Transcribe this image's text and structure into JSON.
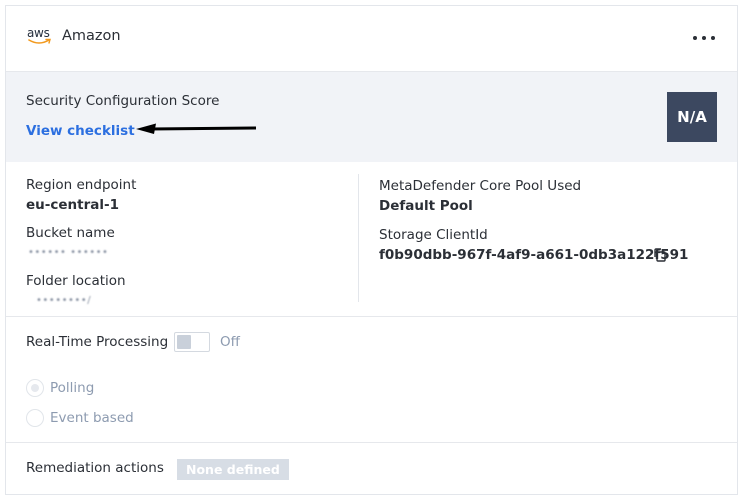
{
  "provider": {
    "logo_text": "aws",
    "name": "Amazon",
    "menu_icon": "more-horizontal-icon"
  },
  "score": {
    "title": "Security Configuration Score",
    "link_label": "View checklist",
    "badge": "N/A",
    "badge_color": "#3c4860"
  },
  "details": {
    "region_label": "Region endpoint",
    "region_value": "eu-central-1",
    "bucket_label": "Bucket name",
    "bucket_value": "•••••• ••••••",
    "folder_label": "Folder location",
    "folder_value": "••••••••/",
    "pool_label": "MetaDefender Core Pool Used",
    "pool_value": "Default Pool",
    "client_label": "Storage ClientId",
    "client_value": "f0b90dbb-967f-4af9-a661-0db3a122f591",
    "copy_icon": "copy-icon"
  },
  "realtime": {
    "label": "Real-Time Processing",
    "toggle_state": "Off",
    "options": [
      {
        "label": "Polling",
        "checked": true
      },
      {
        "label": "Event based",
        "checked": false
      }
    ]
  },
  "remediation": {
    "label": "Remediation actions",
    "value": "None defined"
  },
  "colors": {
    "link": "#2c6fe0",
    "band": "#f1f3f7",
    "muted": "#8d9bb0"
  }
}
